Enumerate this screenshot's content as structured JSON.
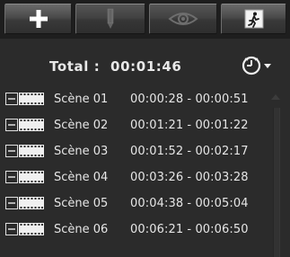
{
  "toolbar": {
    "buttons": [
      {
        "icon": "plus-icon",
        "enabled": true
      },
      {
        "icon": "pencil-icon",
        "enabled": false
      },
      {
        "icon": "eye-icon",
        "enabled": false
      },
      {
        "icon": "exit-icon",
        "enabled": true
      }
    ]
  },
  "total": {
    "text": "Total :  00:01:46"
  },
  "clock_menu": {
    "icon": "clock-icon",
    "dropdown_icon": "caret-down-icon"
  },
  "scenes": [
    {
      "name": "Scène 01",
      "range": "00:00:28 - 00:00:51"
    },
    {
      "name": "Scène 02",
      "range": "00:01:21 - 00:01:22"
    },
    {
      "name": "Scène 03",
      "range": "00:01:52 - 00:02:17"
    },
    {
      "name": "Scène 04",
      "range": "00:03:26 - 00:03:28"
    },
    {
      "name": "Scène 05",
      "range": "00:04:38 - 00:05:04"
    },
    {
      "name": "Scène 06",
      "range": "00:06:21 - 00:06:50"
    }
  ],
  "colors": {
    "background": "#2b2b2b",
    "text": "#e6e6e6",
    "toolbar": "#1e1e1e"
  }
}
